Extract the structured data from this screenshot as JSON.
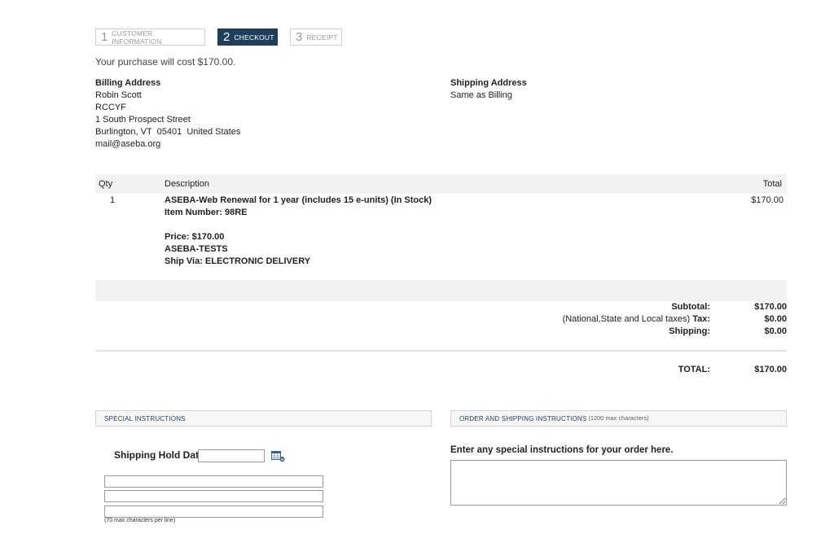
{
  "steps": [
    {
      "num": "1",
      "label": "CUSTOMER INFORMATION"
    },
    {
      "num": "2",
      "label": "CHECKOUT"
    },
    {
      "num": "3",
      "label": "RECEIPT"
    }
  ],
  "intro": "Your purchase will cost $170.00.",
  "billing": {
    "heading": "Billing Address",
    "lines": [
      "Robin Scott",
      "RCCYF",
      "1 South Prospect Street",
      "Burlington, VT  05401  United States",
      "mail@aseba.org"
    ]
  },
  "shipping": {
    "heading": "Shipping Address",
    "value": "Same as Billing"
  },
  "table": {
    "headers": {
      "qty": "Qty",
      "description": "Description",
      "total": "Total"
    },
    "row": {
      "qty": "1",
      "title": "ASEBA-Web Renewal for 1 year (includes 15 e-units) (In Stock)",
      "item_number": "Item Number: 98RE",
      "price": "Price: $170.00",
      "category": "ASEBA-TESTS",
      "ship_via": "Ship Via: ELECTRONIC DELIVERY",
      "total": "$170.00"
    }
  },
  "summary": {
    "subtotal_label": "Subtotal:",
    "subtotal_value": "$170.00",
    "tax_label_prefix": "(National,State and Local taxes)",
    "tax_label": "Tax:",
    "tax_value": "$0.00",
    "shipping_label": "Shipping:",
    "shipping_value": "$0.00",
    "total_label": "TOTAL:",
    "total_value": "$170.00"
  },
  "special": {
    "heading": "SPECIAL INSTRUCTIONS",
    "hold_date_label": "Shipping Hold Date",
    "hold_date_value": "",
    "line_values": [
      "",
      "",
      ""
    ],
    "note": "(70 max characters per line)"
  },
  "order_instructions": {
    "heading": "ORDER AND SHIPPING INSTRUCTIONS",
    "heading_note": "(1200 max characters)",
    "prompt": "Enter any special instructions for your order here.",
    "value": ""
  },
  "colors": {
    "accent": "#1f3e5c",
    "band": "#f2f2f2"
  },
  "icons": {
    "calendar": "calendar-icon"
  }
}
